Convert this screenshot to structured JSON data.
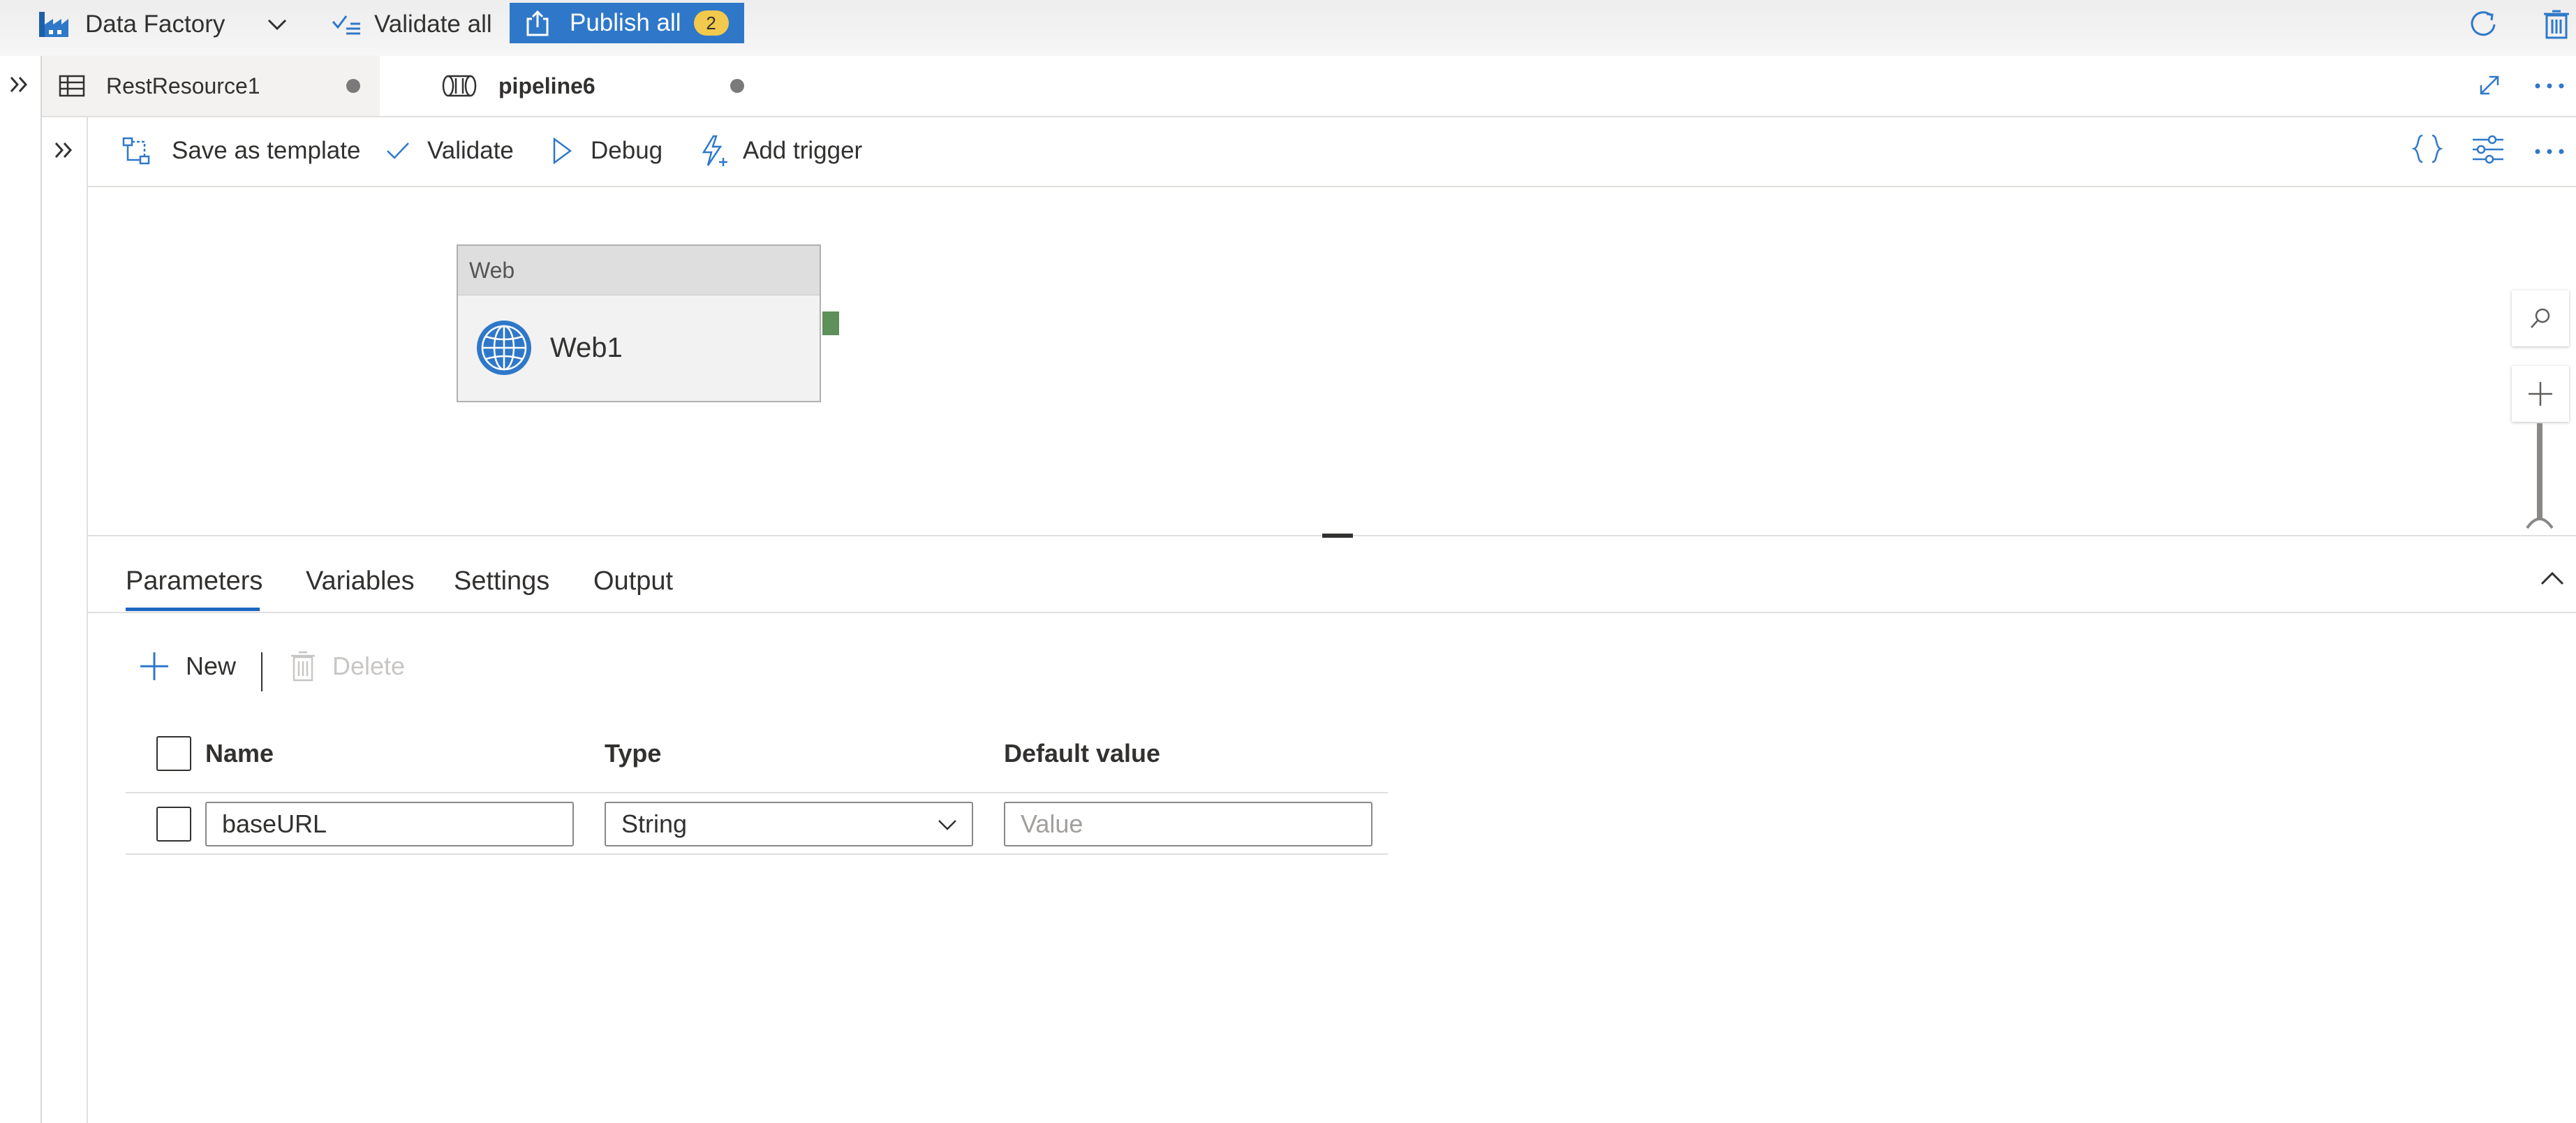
{
  "topbar": {
    "app_name": "Data Factory",
    "validate_all_label": "Validate all",
    "publish_all_label": "Publish all",
    "publish_count": "2"
  },
  "tabs": [
    {
      "label": "RestResource1"
    },
    {
      "label": "pipeline6"
    }
  ],
  "toolbar": {
    "save_template_label": "Save as template",
    "validate_label": "Validate",
    "debug_label": "Debug",
    "add_trigger_label": "Add trigger"
  },
  "activity": {
    "type": "Web",
    "name": "Web1"
  },
  "pane_tabs": [
    {
      "label": "Parameters",
      "active": true
    },
    {
      "label": "Variables"
    },
    {
      "label": "Settings"
    },
    {
      "label": "Output"
    }
  ],
  "params": {
    "new_label": "New",
    "delete_label": "Delete",
    "columns": [
      "Name",
      "Type",
      "Default value"
    ],
    "rows": [
      {
        "name": "baseURL",
        "type": "String",
        "default_placeholder": "Value"
      }
    ]
  },
  "colors": {
    "accent": "#2f78c9",
    "badge": "#f2c94c",
    "tab_underline": "#1a66c0",
    "port": "#5f8f5a"
  }
}
